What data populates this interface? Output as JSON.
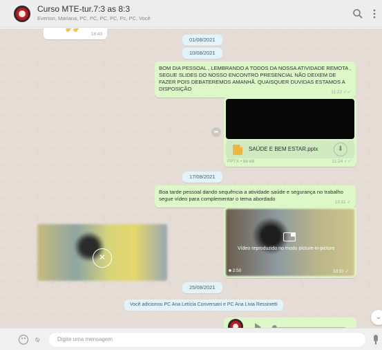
{
  "header": {
    "title": "Curso MTE-tur.7:3 as 8:3",
    "subtitle": "Everton, Mariana, PC, PC, PC, PC, Pc, PC, Você"
  },
  "chat": {
    "top_time": "18:43",
    "dates": [
      "01/08/2021",
      "10/08/2021",
      "17/08/2021",
      "25/08/2021"
    ],
    "msg1": {
      "text": "BOM DIA PESSOAL , LEMBRANDO A TODOS DA NOSSA ATIVIDADE REMOTA , SEGUE SLIDES DO NOSSO ENCONTRO PRESENCIAL NÃO DEIXEM DE FAZER POIS DEBATEREMOS AMANHÃ. QUAISQUER DUVIDAS ESTAMOS A DISPOSIÇÃO",
      "time": "11:22"
    },
    "file": {
      "name": "SAÚDE E BEM ESTAR.pptx",
      "info": "PPTX • 86 kB",
      "time": "11:24"
    },
    "msg2": {
      "text": "Boa tarde pessoal dando sequência a atividade saúde e segurança no trabalho segue vídeo para complementar o tema abordado",
      "time": "13:11"
    },
    "video": {
      "pip_text": "Vídeo reproduzido no modo picture-in-picture",
      "duration": "2:50",
      "time": "13:11"
    },
    "system_msg": "Você adicionou PC Ana Letícia Conversani e PC Ana Livia Ressinetti"
  },
  "footer": {
    "placeholder": "Digite uma mensagem"
  },
  "colors": {
    "outgoing_bubble": "#dcf8c6",
    "chat_background": "#e5ddd5",
    "read_check": "#4fc3f7"
  }
}
